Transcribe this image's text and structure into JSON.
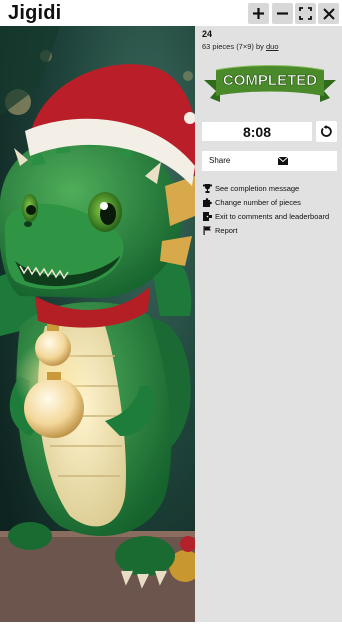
{
  "app": {
    "title": "Jigidi"
  },
  "toolbar": {
    "zoom_in_icon": "plus-icon",
    "zoom_out_icon": "minus-icon",
    "fullscreen_icon": "fullscreen-icon",
    "close_icon": "close-icon"
  },
  "puzzle": {
    "number": "24",
    "info_prefix": "63 pieces (7×9) by ",
    "author": "duo",
    "banner_text": "COMPLETED",
    "image_subject": "Green baby dragon in a red Santa hat holding glowing ornaments"
  },
  "timer": {
    "value": "8:08",
    "reset_icon": "restart-icon"
  },
  "share": {
    "label": "Share",
    "icon": "envelope-icon"
  },
  "menu": [
    {
      "label": "See completion message",
      "icon": "trophy-icon"
    },
    {
      "label": "Change number of pieces",
      "icon": "puzzle-piece-icon"
    },
    {
      "label": "Exit to comments and leaderboard",
      "icon": "exit-icon"
    },
    {
      "label": "Report",
      "icon": "flag-icon"
    }
  ],
  "colors": {
    "panel_bg": "#e1e1e1",
    "banner_green": "#4a8a2a",
    "button_bg": "#d8d8d8"
  }
}
